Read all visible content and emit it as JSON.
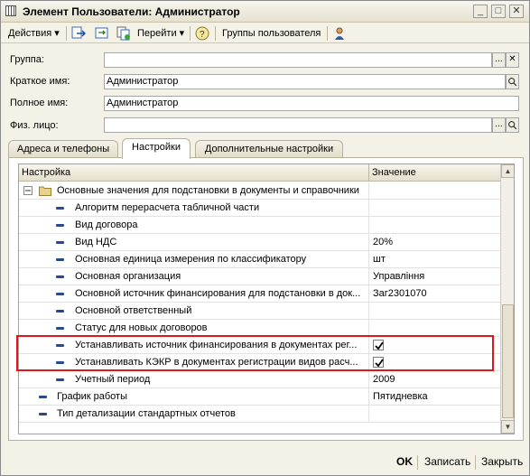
{
  "window": {
    "title": "Элемент Пользователи: Администратор"
  },
  "toolbar": {
    "actions_label": "Действия",
    "goto_label": "Перейти",
    "help_label": "?",
    "groups_label": "Группы пользователя"
  },
  "fields": {
    "group_label": "Группа:",
    "group_value": "",
    "short_name_label": "Краткое имя:",
    "short_name_value": "Администратор",
    "full_name_label": "Полное имя:",
    "full_name_value": "Администратор",
    "person_label": "Физ. лицо:",
    "person_value": ""
  },
  "tabs": [
    {
      "label": "Адреса и телефоны"
    },
    {
      "label": "Настройки"
    },
    {
      "label": "Дополнительные настройки"
    }
  ],
  "grid": {
    "col_setting": "Настройка",
    "col_value": "Значение",
    "group_row": "Основные значения для подстановки в документы и справочники",
    "rows": [
      {
        "name": "Алгоритм перерасчета табличной части",
        "value": ""
      },
      {
        "name": "Вид договора",
        "value": ""
      },
      {
        "name": "Вид НДС",
        "value": "20%"
      },
      {
        "name": "Основная единица измерения по классификатору",
        "value": "шт"
      },
      {
        "name": "Основная организация",
        "value": "Управління"
      },
      {
        "name": "Основной источник финансирования для подстановки в док...",
        "value": "Заг2301070"
      },
      {
        "name": "Основной ответственный",
        "value": ""
      },
      {
        "name": "Статус для новых договоров",
        "value": ""
      },
      {
        "name": "Устанавливать источник финансирования в документах рег...",
        "checked": true
      },
      {
        "name": "Устанавливать КЭКР в документах регистрации видов расч...",
        "checked": true
      },
      {
        "name": "Учетный период",
        "value": "2009"
      }
    ],
    "top_rows": [
      {
        "name": "График работы",
        "value": "Пятидневка"
      },
      {
        "name": "Тип детализации стандартных отчетов",
        "value": ""
      }
    ]
  },
  "bottom": {
    "ok_label": "OK",
    "save_label": "Записать",
    "close_label": "Закрыть"
  }
}
